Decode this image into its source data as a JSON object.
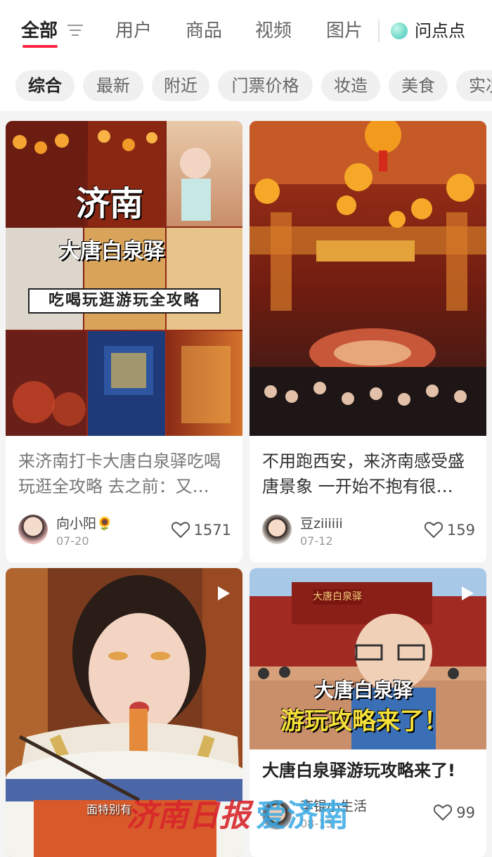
{
  "tabs": [
    {
      "label": "全部",
      "active": true
    },
    {
      "label": "用户",
      "active": false
    },
    {
      "label": "商品",
      "active": false
    },
    {
      "label": "视频",
      "active": false
    },
    {
      "label": "图片",
      "active": false
    }
  ],
  "ask": {
    "label": "问点点"
  },
  "chips": [
    "综合",
    "最新",
    "附近",
    "门票价格",
    "妆造",
    "美食",
    "实况"
  ],
  "cards": [
    {
      "cover_text": {
        "line1": "济南",
        "line2": "大唐白泉驿",
        "line3": "吃喝玩逛游玩全攻略"
      },
      "title": "来济南打卡大唐白泉驿吃喝玩逛全攻略 去之前：又…",
      "author": "向小阳🌻",
      "date": "07-20",
      "likes": "1571"
    },
    {
      "title": "不用跑西安，来济南感受盛唐景象 一开始不抱有很…",
      "author": "豆ziiiiii",
      "date": "07-12",
      "likes": "159"
    },
    {
      "cover_text": {
        "caption": "面特别有"
      },
      "title": "",
      "author": "",
      "date": "",
      "likes": ""
    },
    {
      "cover_text": {
        "line1": "大唐白泉驿",
        "line2": "游玩攻略来了！",
        "sign": "大唐白泉驿"
      },
      "title": "大唐白泉驿游玩攻略来了!",
      "author": "李锟小生活",
      "date": "08-13",
      "likes": "99"
    }
  ],
  "watermark": {
    "left": "济南日报",
    "right": "爱济南"
  },
  "colors": {
    "accent": "#ff2442",
    "chip_bg": "#f0f0f0",
    "page_bg": "#f4f4f4"
  }
}
